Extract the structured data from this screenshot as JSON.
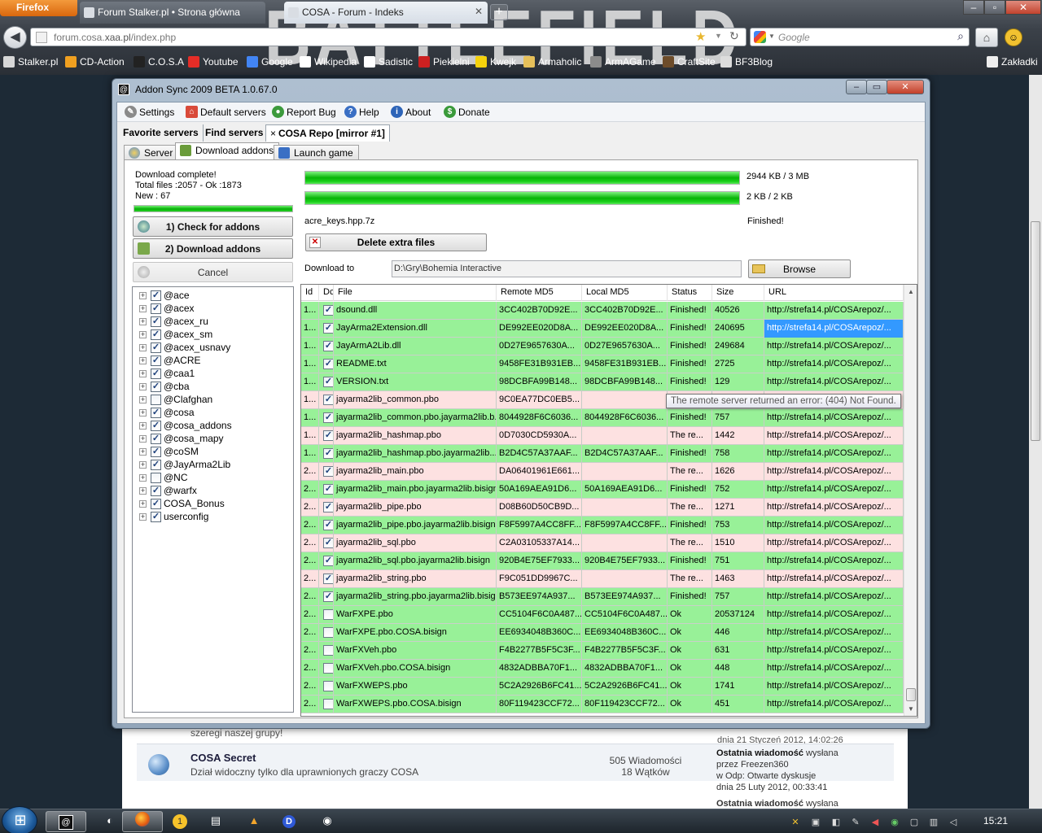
{
  "browser": {
    "menu_button": "Firefox",
    "tabs": [
      {
        "title": "Forum Stalker.pl • Strona główna"
      },
      {
        "title": "COSA - Forum - Indeks"
      }
    ],
    "watermark": "BATTLEFIELD",
    "url_prefix": "forum.cosa.",
    "url_host": "xaa.pl",
    "url_suffix": "/index.php",
    "search_placeholder": "Google",
    "bookmarks": [
      {
        "label": "Stalker.pl",
        "color": "#d7d7d7"
      },
      {
        "label": "CD-Action",
        "color": "#f0a020"
      },
      {
        "label": "C.O.S.A",
        "color": "#222222"
      },
      {
        "label": "Youtube",
        "color": "#e52d27"
      },
      {
        "label": "Google",
        "color": "#4285f4"
      },
      {
        "label": "Wikipedia",
        "color": "#ffffff"
      },
      {
        "label": "Sadistic",
        "color": "#ffffff"
      },
      {
        "label": "Piekielni",
        "color": "#cc2020"
      },
      {
        "label": "Kwejk",
        "color": "#f5d20c"
      },
      {
        "label": "Armaholic",
        "color": "#e6c05a"
      },
      {
        "label": "ArmAGame",
        "color": "#8b8b8b"
      },
      {
        "label": "CraftSite",
        "color": "#6d4c2a"
      },
      {
        "label": "BF3Blog",
        "color": "#dddddd"
      }
    ],
    "bookmarks_menu": "Zakładki"
  },
  "forum": {
    "clipped_text": "szeregi naszej grupy!",
    "clipped_date": "dnia 21 Styczeń 2012, 14:02:26",
    "row": {
      "title": "COSA Secret",
      "description": "Dział widoczny tylko dla uprawnionych graczy COSA",
      "posts": "505 Wiadomości",
      "topics": "18 Wątków",
      "last_line1": "Ostatnia wiadomość",
      "last_line1_suffix": " wysłana",
      "last_line2": "przez Freezen360",
      "last_line3": "w Odp: Otwarte dyskusje",
      "last_line4": "dnia 25 Luty 2012, 00:33:41"
    },
    "next_row_last": "Ostatnia wiadomość",
    "next_row_last_suffix": " wysłana"
  },
  "app": {
    "title": "Addon Sync 2009 BETA 1.0.67.0",
    "menu": [
      {
        "label": "Settings",
        "icon": "wrench-icon",
        "color": "#7a7a7a"
      },
      {
        "label": "Default servers",
        "icon": "home-icon",
        "color": "#d94a3a"
      },
      {
        "label": "Report Bug",
        "icon": "globe-icon",
        "color": "#3c9a3c"
      },
      {
        "label": "Help",
        "icon": "help-icon",
        "color": "#3a6fc4"
      },
      {
        "label": "About",
        "icon": "info-icon",
        "color": "#2d64b8"
      },
      {
        "label": "Donate",
        "icon": "dollar-icon",
        "color": "#3a9a3a"
      }
    ],
    "server_tabs": [
      "Favorite servers",
      "Find servers",
      "COSA Repo [mirror #1]"
    ],
    "server_tab_close": "×",
    "sub_tabs": [
      "Server",
      "Download addons",
      "Launch game"
    ],
    "status": {
      "line1": "Download complete!",
      "line2": "Total files :2057 - Ok :1873",
      "line3": "New : 67"
    },
    "left_progress": 1.0,
    "buttons": {
      "check": "1) Check for addons",
      "download": "2) Download addons",
      "cancel": "Cancel",
      "delete_extra": "Delete extra files",
      "browse": "Browse"
    },
    "progress1": {
      "value": 1.0,
      "label": "2944 KB / 3 MB"
    },
    "progress2": {
      "value": 1.0,
      "label": "2 KB / 2 KB"
    },
    "current_file": "acre_keys.hpp.7z",
    "current_status": "Finished!",
    "download_to_label": "Download to",
    "download_to_path": "D:\\Gry\\Bohemia Interactive",
    "tree": [
      {
        "label": "@ace",
        "checked": true
      },
      {
        "label": "@acex",
        "checked": true
      },
      {
        "label": "@acex_ru",
        "checked": true
      },
      {
        "label": "@acex_sm",
        "checked": true
      },
      {
        "label": "@acex_usnavy",
        "checked": true
      },
      {
        "label": "@ACRE",
        "checked": true
      },
      {
        "label": "@caa1",
        "checked": true
      },
      {
        "label": "@cba",
        "checked": true
      },
      {
        "label": "@Clafghan",
        "checked": false
      },
      {
        "label": "@cosa",
        "checked": true
      },
      {
        "label": "@cosa_addons",
        "checked": true
      },
      {
        "label": "@cosa_mapy",
        "checked": true
      },
      {
        "label": "@coSM",
        "checked": true
      },
      {
        "label": "@JayArma2Lib",
        "checked": true
      },
      {
        "label": "@NC",
        "checked": false
      },
      {
        "label": "@warfx",
        "checked": true
      },
      {
        "label": "COSA_Bonus",
        "checked": true
      },
      {
        "label": "userconfig",
        "checked": true
      }
    ],
    "grid": {
      "columns": [
        "Id",
        "Dc",
        "File",
        "Remote MD5",
        "Local MD5",
        "Status",
        "Size",
        "URL"
      ],
      "rows": [
        {
          "id": "1...",
          "checked": true,
          "file": "dsound.dll",
          "remote": "3CC402B70D92E...",
          "local": "3CC402B70D92E...",
          "status": "Finished!",
          "size": "40526",
          "url": "http://strefa14.pl/COSArepoz/...",
          "state": "ok"
        },
        {
          "id": "1...",
          "checked": true,
          "file": "JayArma2Extension.dll",
          "remote": "DE992EE020D8A...",
          "local": "DE992EE020D8A...",
          "status": "Finished!",
          "size": "240695",
          "url": "http://strefa14.pl/COSArepoz/...",
          "state": "ok",
          "url_selected": true
        },
        {
          "id": "1...",
          "checked": true,
          "file": "JayArmA2Lib.dll",
          "remote": "0D27E9657630A...",
          "local": "0D27E9657630A...",
          "status": "Finished!",
          "size": "249684",
          "url": "http://strefa14.pl/COSArepoz/...",
          "state": "ok"
        },
        {
          "id": "1...",
          "checked": true,
          "file": "README.txt",
          "remote": "9458FE31B931EB...",
          "local": "9458FE31B931EB...",
          "status": "Finished!",
          "size": "2725",
          "url": "http://strefa14.pl/COSArepoz/...",
          "state": "ok"
        },
        {
          "id": "1...",
          "checked": true,
          "file": "VERSION.txt",
          "remote": "98DCBFA99B148...",
          "local": "98DCBFA99B148...",
          "status": "Finished!",
          "size": "129",
          "url": "http://strefa14.pl/COSArepoz/...",
          "state": "ok"
        },
        {
          "id": "1...",
          "checked": true,
          "file": "jayarma2lib_common.pbo",
          "remote": "9C0EA77DC0EB5...",
          "local": "",
          "status": "",
          "size": "",
          "url": "",
          "state": "err"
        },
        {
          "id": "1...",
          "checked": true,
          "file": "jayarma2lib_common.pbo.jayarma2lib.b...",
          "remote": "8044928F6C6036...",
          "local": "8044928F6C6036...",
          "status": "Finished!",
          "size": "757",
          "url": "http://strefa14.pl/COSArepoz/...",
          "state": "ok"
        },
        {
          "id": "1...",
          "checked": true,
          "file": "jayarma2lib_hashmap.pbo",
          "remote": "0D7030CD5930A...",
          "local": "",
          "status": "The re...",
          "size": "1442",
          "url": "http://strefa14.pl/COSArepoz/...",
          "state": "err"
        },
        {
          "id": "1...",
          "checked": true,
          "file": "jayarma2lib_hashmap.pbo.jayarma2lib....",
          "remote": "B2D4C57A37AAF...",
          "local": "B2D4C57A37AAF...",
          "status": "Finished!",
          "size": "758",
          "url": "http://strefa14.pl/COSArepoz/...",
          "state": "ok"
        },
        {
          "id": "2...",
          "checked": true,
          "file": "jayarma2lib_main.pbo",
          "remote": "DA06401961E661...",
          "local": "",
          "status": "The re...",
          "size": "1626",
          "url": "http://strefa14.pl/COSArepoz/...",
          "state": "err"
        },
        {
          "id": "2...",
          "checked": true,
          "file": "jayarma2lib_main.pbo.jayarma2lib.bisign",
          "remote": "50A169AEA91D6...",
          "local": "50A169AEA91D6...",
          "status": "Finished!",
          "size": "752",
          "url": "http://strefa14.pl/COSArepoz/...",
          "state": "ok"
        },
        {
          "id": "2...",
          "checked": true,
          "file": "jayarma2lib_pipe.pbo",
          "remote": "D08B60D50CB9D...",
          "local": "",
          "status": "The re...",
          "size": "1271",
          "url": "http://strefa14.pl/COSArepoz/...",
          "state": "err"
        },
        {
          "id": "2...",
          "checked": true,
          "file": "jayarma2lib_pipe.pbo.jayarma2lib.bisign",
          "remote": "F8F5997A4CC8FF...",
          "local": "F8F5997A4CC8FF...",
          "status": "Finished!",
          "size": "753",
          "url": "http://strefa14.pl/COSArepoz/...",
          "state": "ok"
        },
        {
          "id": "2...",
          "checked": true,
          "file": "jayarma2lib_sql.pbo",
          "remote": "C2A03105337A14...",
          "local": "",
          "status": "The re...",
          "size": "1510",
          "url": "http://strefa14.pl/COSArepoz/...",
          "state": "err"
        },
        {
          "id": "2...",
          "checked": true,
          "file": "jayarma2lib_sql.pbo.jayarma2lib.bisign",
          "remote": "920B4E75EF7933...",
          "local": "920B4E75EF7933...",
          "status": "Finished!",
          "size": "751",
          "url": "http://strefa14.pl/COSArepoz/...",
          "state": "ok"
        },
        {
          "id": "2...",
          "checked": true,
          "file": "jayarma2lib_string.pbo",
          "remote": "F9C051DD9967C...",
          "local": "",
          "status": "The re...",
          "size": "1463",
          "url": "http://strefa14.pl/COSArepoz/...",
          "state": "err"
        },
        {
          "id": "2...",
          "checked": true,
          "file": "jayarma2lib_string.pbo.jayarma2lib.bisign",
          "remote": "B573EE974A937...",
          "local": "B573EE974A937...",
          "status": "Finished!",
          "size": "757",
          "url": "http://strefa14.pl/COSArepoz/...",
          "state": "ok"
        },
        {
          "id": "2...",
          "checked": false,
          "file": "WarFXPE.pbo",
          "remote": "CC5104F6C0A487...",
          "local": "CC5104F6C0A487...",
          "status": "Ok",
          "size": "20537124",
          "url": "http://strefa14.pl/COSArepoz/...",
          "state": "ok"
        },
        {
          "id": "2...",
          "checked": false,
          "file": "WarFXPE.pbo.COSA.bisign",
          "remote": "EE6934048B360C...",
          "local": "EE6934048B360C...",
          "status": "Ok",
          "size": "446",
          "url": "http://strefa14.pl/COSArepoz/...",
          "state": "ok"
        },
        {
          "id": "2...",
          "checked": false,
          "file": "WarFXVeh.pbo",
          "remote": "F4B2277B5F5C3F...",
          "local": "F4B2277B5F5C3F...",
          "status": "Ok",
          "size": "631",
          "url": "http://strefa14.pl/COSArepoz/...",
          "state": "ok"
        },
        {
          "id": "2...",
          "checked": false,
          "file": "WarFXVeh.pbo.COSA.bisign",
          "remote": "4832ADBBA70F1...",
          "local": "4832ADBBA70F1...",
          "status": "Ok",
          "size": "448",
          "url": "http://strefa14.pl/COSArepoz/...",
          "state": "ok"
        },
        {
          "id": "2...",
          "checked": false,
          "file": "WarFXWEPS.pbo",
          "remote": "5C2A2926B6FC41...",
          "local": "5C2A2926B6FC41...",
          "status": "Ok",
          "size": "1741",
          "url": "http://strefa14.pl/COSArepoz/...",
          "state": "ok"
        },
        {
          "id": "2...",
          "checked": false,
          "file": "WarFXWEPS.pbo.COSA.bisign",
          "remote": "80F119423CCF72...",
          "local": "80F119423CCF72...",
          "status": "Ok",
          "size": "451",
          "url": "http://strefa14.pl/COSArepoz/...",
          "state": "ok"
        }
      ]
    },
    "tooltip": "The remote server returned an error: (404) Not Found."
  },
  "taskbar": {
    "clock": "15:21"
  },
  "colors": {
    "row_ok": "#98f198",
    "row_err": "#fde1e1",
    "progress": "#06b406",
    "selection": "#3399ff"
  }
}
